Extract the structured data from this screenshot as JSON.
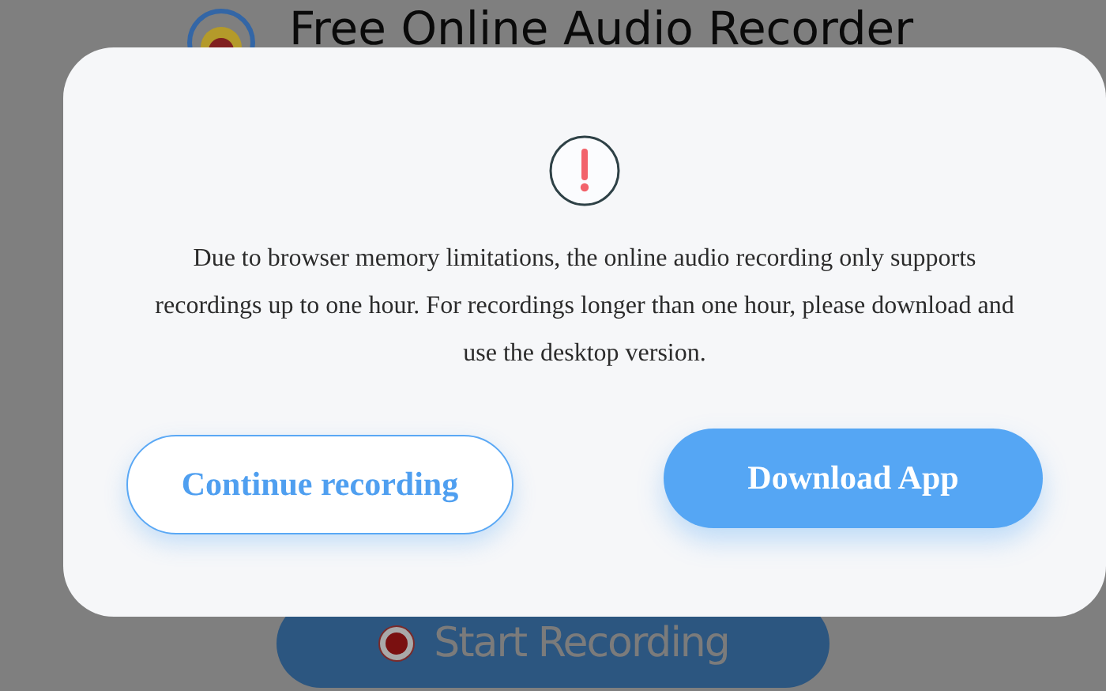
{
  "page": {
    "title": "Free Online Audio Recorder",
    "start_button": "Start Recording"
  },
  "dialog": {
    "message": "Due to browser memory limitations, the online audio recording only supports recordings up to one hour. For recordings longer than one hour, please download and use the desktop version.",
    "buttons": [
      {
        "label": "Continue recording",
        "kind": "secondary"
      },
      {
        "label": "Download App",
        "kind": "primary"
      }
    ]
  }
}
